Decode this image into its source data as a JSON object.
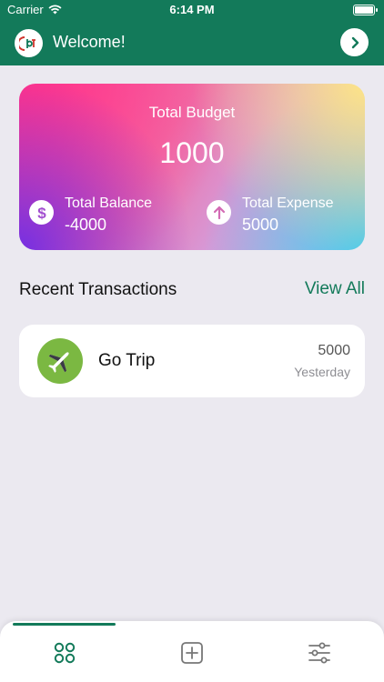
{
  "status_bar": {
    "carrier": "Carrier",
    "time": "6:14 PM"
  },
  "header": {
    "welcome": "Welcome!"
  },
  "budget_card": {
    "title": "Total Budget",
    "amount": "1000",
    "balance_label": "Total Balance",
    "balance_value": "-4000",
    "expense_label": "Total Expense",
    "expense_value": "5000"
  },
  "transactions": {
    "section_title": "Recent Transactions",
    "view_all_label": "View All",
    "items": [
      {
        "name": "Go Trip",
        "amount": "5000",
        "date": "Yesterday",
        "icon": "airplane-icon"
      }
    ]
  },
  "tab_bar": {
    "tabs": [
      {
        "icon": "dashboard-icon",
        "active": true
      },
      {
        "icon": "add-icon",
        "active": false
      },
      {
        "icon": "sliders-icon",
        "active": false
      }
    ]
  },
  "colors": {
    "brand": "#137a5a",
    "background": "#ebe9f0",
    "transaction_icon_bg": "#7bb842"
  }
}
